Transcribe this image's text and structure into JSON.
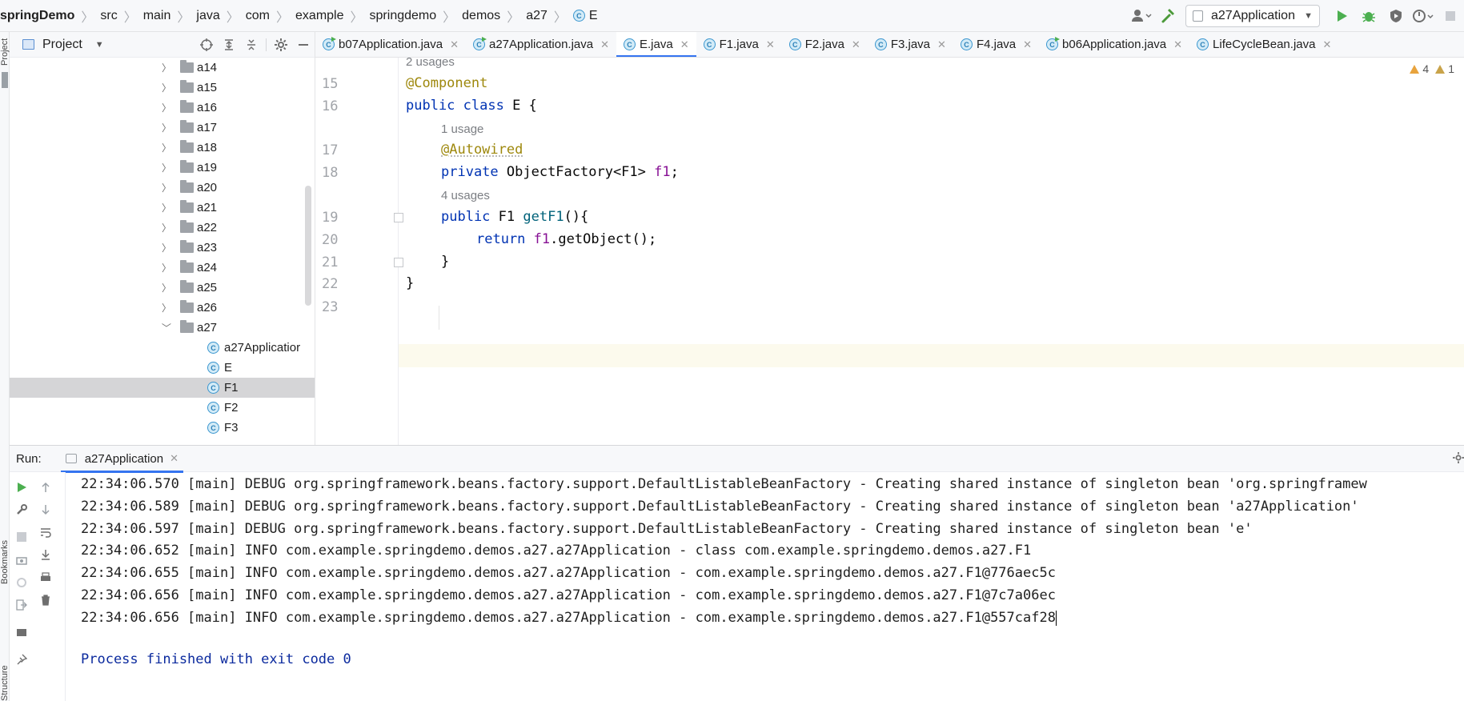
{
  "breadcrumb": [
    "springDemo",
    "src",
    "main",
    "java",
    "com",
    "example",
    "springdemo",
    "demos",
    "a27",
    "E"
  ],
  "toolbar": {
    "run_config": "a27Application"
  },
  "left_strip": {
    "top_label": "Project",
    "bottom_labels": [
      "Bookmarks",
      "Structure"
    ]
  },
  "project_panel": {
    "title": "Project",
    "folders": [
      "a14",
      "a15",
      "a16",
      "a17",
      "a18",
      "a19",
      "a20",
      "a21",
      "a22",
      "a23",
      "a24",
      "a25",
      "a26",
      "a27"
    ],
    "a27_children": [
      "a27Applicatior",
      "E",
      "F1",
      "F2",
      "F3"
    ],
    "selected": "F1"
  },
  "tabs": [
    {
      "label": "b07Application.java",
      "active": false
    },
    {
      "label": "a27Application.java",
      "active": false
    },
    {
      "label": "E.java",
      "active": true
    },
    {
      "label": "F1.java",
      "active": false
    },
    {
      "label": "F2.java",
      "active": false
    },
    {
      "label": "F3.java",
      "active": false
    },
    {
      "label": "F4.java",
      "active": false
    },
    {
      "label": "b06Application.java",
      "active": false
    },
    {
      "label": "LifeCycleBean.java",
      "active": false
    }
  ],
  "editor": {
    "inspections": {
      "warnings": "4",
      "weak_warnings": "1"
    },
    "hints": {
      "class_usages": "2 usages",
      "field_usages": "1 usage",
      "method_usages": "4 usages"
    },
    "line_numbers": [
      "15",
      "16",
      "17",
      "18",
      "19",
      "20",
      "21",
      "22",
      "23"
    ],
    "code": {
      "l15_ann": "@Component",
      "l16_kw": "public class",
      "l16_rest": " E {",
      "l17_ann": "@Autowired",
      "l18_kw": "private",
      "l18_type": " ObjectFactory<F1> ",
      "l18_field": "f1",
      "l18_end": ";",
      "l19_kw": "public",
      "l19_type": " F1 ",
      "l19_meth": "getF1",
      "l19_end": "(){",
      "l20_kw": "return",
      "l20_sp": " ",
      "l20_field": "f1",
      "l20_end": ".getObject();",
      "l21": "}",
      "l22": "}"
    }
  },
  "run_window": {
    "label": "Run:",
    "tab": "a27Application",
    "console_lines": [
      "22:34:06.570 [main] DEBUG org.springframework.beans.factory.support.DefaultListableBeanFactory - Creating shared instance of singleton bean 'org.springframew",
      "22:34:06.589 [main] DEBUG org.springframework.beans.factory.support.DefaultListableBeanFactory - Creating shared instance of singleton bean 'a27Application'",
      "22:34:06.597 [main] DEBUG org.springframework.beans.factory.support.DefaultListableBeanFactory - Creating shared instance of singleton bean 'e'",
      "22:34:06.652 [main] INFO com.example.springdemo.demos.a27.a27Application - class com.example.springdemo.demos.a27.F1",
      "22:34:06.655 [main] INFO com.example.springdemo.demos.a27.a27Application - com.example.springdemo.demos.a27.F1@776aec5c",
      "22:34:06.656 [main] INFO com.example.springdemo.demos.a27.a27Application - com.example.springdemo.demos.a27.F1@7c7a06ec",
      "22:34:06.656 [main] INFO com.example.springdemo.demos.a27.a27Application - com.example.springdemo.demos.a27.F1@557caf28"
    ],
    "exit_message": "Process finished with exit code 0"
  },
  "colors": {
    "keyword": "#0033b3",
    "annotation": "#9e880d",
    "field": "#871094",
    "method": "#00627a",
    "accent": "#3574f0",
    "run_green": "#4caf50"
  }
}
